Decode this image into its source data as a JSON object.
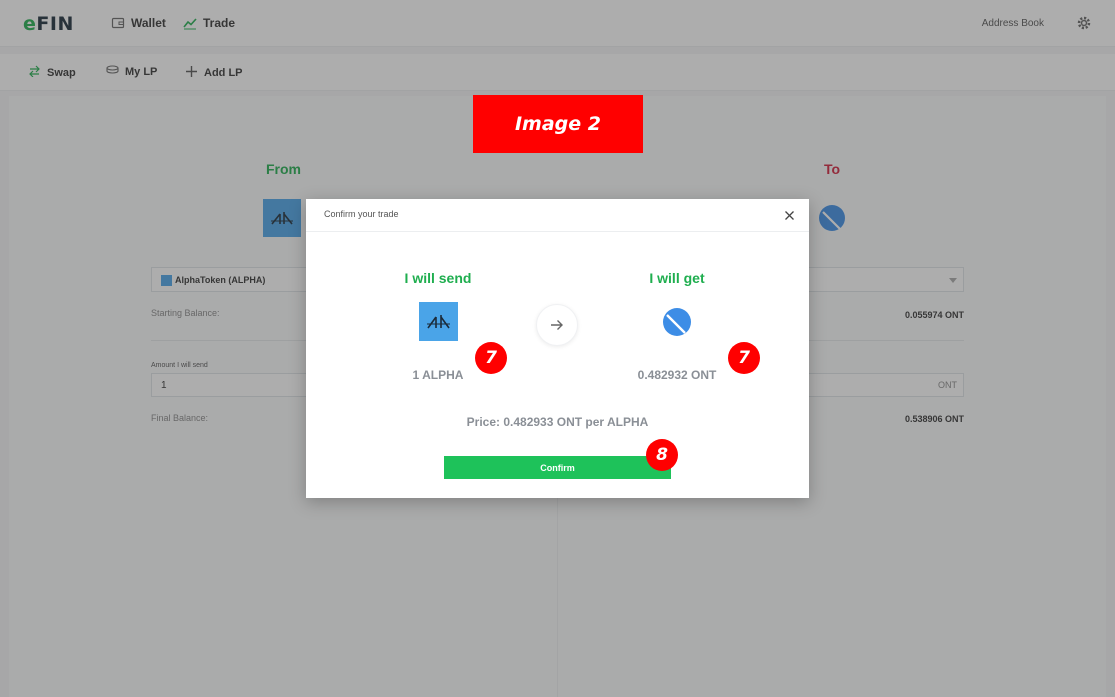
{
  "app": {
    "logo_e": "e",
    "logo_rest": "FIN"
  },
  "topnav": {
    "wallet_label": "Wallet",
    "trade_label": "Trade",
    "address_book_label": "Address Book"
  },
  "subnav": {
    "swap_label": "Swap",
    "mylp_label": "My LP",
    "addlp_label": "Add LP"
  },
  "background": {
    "from_label": "From",
    "to_label": "To",
    "token_selected": "AlphaToken (ALPHA)",
    "starting_balance_label": "Starting Balance:",
    "starting_balance_right": "0.055974 ONT",
    "amount_send_label": "Amount I will send",
    "amount_send_value": "1",
    "amount_right_unit": "ONT",
    "final_balance_label": "Final Balance:",
    "final_balance_right": "0.538906 ONT"
  },
  "annotation": {
    "banner_text": "Image 2",
    "badge_1": "7",
    "badge_2": "7",
    "badge_3": "8"
  },
  "modal": {
    "title": "Confirm your trade",
    "send_heading": "I will send",
    "get_heading": "I will get",
    "send_amount": "1 ALPHA",
    "get_amount": "0.482932 ONT",
    "price_text": "Price: 0.482933 ONT per ALPHA",
    "confirm_label": "Confirm"
  },
  "colors": {
    "green": "#1fae4f",
    "confirm_green": "#1ec25a",
    "red": "#d21f3c",
    "annotation_red": "#ff0000",
    "alpha_blue": "#4aa4e8",
    "ont_blue": "#3d8de6"
  },
  "icons": {
    "wallet": "wallet-icon",
    "trade": "trend-chart-icon",
    "gear": "gear-icon",
    "swap": "swap-arrows-icon",
    "mylp": "coin-stack-icon",
    "addlp": "plus-icon",
    "close": "close-icon",
    "arrow": "arrow-right-icon"
  }
}
